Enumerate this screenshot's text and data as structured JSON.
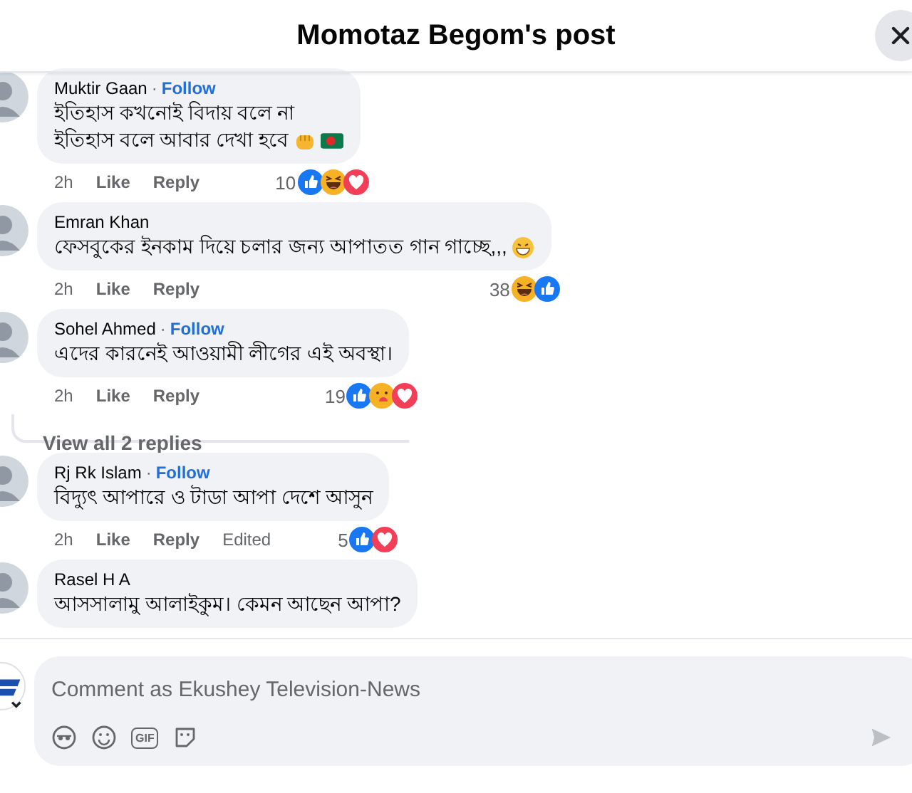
{
  "header": {
    "title": "Momotaz Begom's post"
  },
  "comments": [
    {
      "author": "Muktir Gaan",
      "separator": "·",
      "follow": "Follow",
      "lines": [
        "ইতিহাস কখনোই বিদায় বলে না",
        "ইতিহাস বলে আবার দেখা হবে"
      ],
      "emojis": [
        {
          "kind": "fist"
        },
        {
          "kind": "flag"
        }
      ],
      "time": "2h",
      "like": "Like",
      "reply": "Reply",
      "count": "10",
      "reactions": [
        {
          "kind": "like"
        },
        {
          "kind": "haha"
        },
        {
          "kind": "love"
        }
      ]
    },
    {
      "author": "Emran Khan",
      "lines": [
        "ফেসবুকের ইনকাম দিয়ে চলার জন্য আপাতত গান গাচ্ছে,,,"
      ],
      "emojis": [
        {
          "kind": "grin"
        }
      ],
      "time": "2h",
      "like": "Like",
      "reply": "Reply",
      "count": "38",
      "reactions": [
        {
          "kind": "haha"
        },
        {
          "kind": "like"
        }
      ]
    },
    {
      "author": "Sohel Ahmed",
      "separator": "·",
      "follow": "Follow",
      "lines": [
        "এদের কারনেই আওয়ামী লীগের এই অবস্থা।"
      ],
      "time": "2h",
      "like": "Like",
      "reply": "Reply",
      "count": "19",
      "reactions": [
        {
          "kind": "like"
        },
        {
          "kind": "care"
        },
        {
          "kind": "love"
        }
      ],
      "view_replies": "View all 2 replies"
    },
    {
      "author": "Rj Rk Islam",
      "separator": "·",
      "follow": "Follow",
      "lines": [
        "বিদ্যুৎ আপারে ও টাডা আপা দেশে আসুন"
      ],
      "time": "2h",
      "like": "Like",
      "reply": "Reply",
      "edited": "Edited",
      "count": "5",
      "reactions": [
        {
          "kind": "like"
        },
        {
          "kind": "love"
        }
      ]
    },
    {
      "author": "Rasel H A",
      "lines": [
        "আসসালামু আলাইকুম। কেমন আছেন আপা?"
      ]
    }
  ],
  "composer": {
    "placeholder": "Comment as Ekushey Television-News",
    "gif": "GIF"
  }
}
